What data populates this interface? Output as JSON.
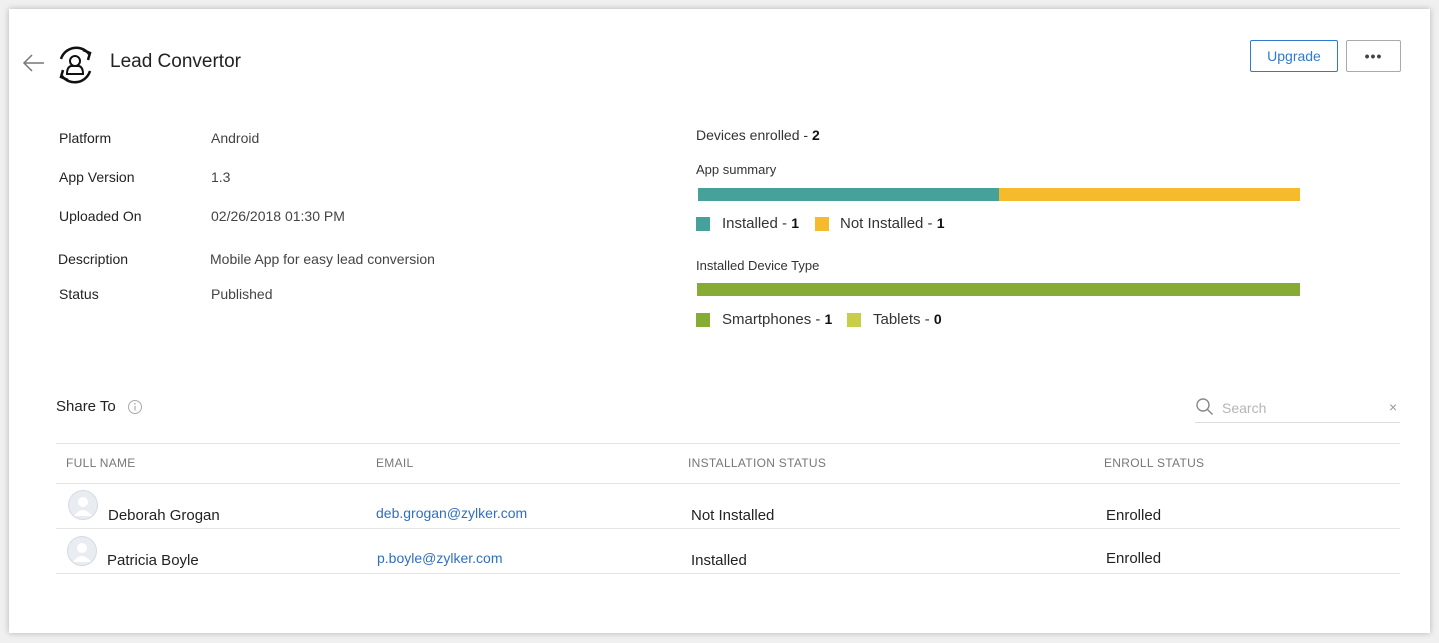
{
  "header": {
    "title": "Lead Convertor",
    "upgrade_label": "Upgrade",
    "more_label": "•••"
  },
  "details": {
    "platform": {
      "label": "Platform",
      "value": "Android"
    },
    "app_version": {
      "label": "App Version",
      "value": "1.3"
    },
    "uploaded_on": {
      "label": "Uploaded On",
      "value": "02/26/2018 01:30 PM"
    },
    "description": {
      "label": "Description",
      "value": "Mobile App for easy lead conversion"
    },
    "status": {
      "label": "Status",
      "value": "Published"
    }
  },
  "summary": {
    "devices_enrolled_label": "Devices enrolled - ",
    "devices_enrolled_count": "2",
    "app_summary": {
      "title": "App summary",
      "installed_label": "Installed - ",
      "installed_count": "1",
      "not_installed_label": "Not Installed - ",
      "not_installed_count": "1",
      "installed_fraction": 0.5,
      "installed_color": "#45a199",
      "not_installed_color": "#f5bb2d"
    },
    "device_type": {
      "title": "Installed Device Type",
      "smartphones_label": "Smartphones - ",
      "smartphones_count": "1",
      "tablets_label": "Tablets - ",
      "tablets_count": "0",
      "smartphones_fraction": 1.0,
      "smartphones_color": "#86ac35",
      "tablets_color": "#c8ce47"
    }
  },
  "share": {
    "title": "Share To",
    "search_placeholder": "Search",
    "clear_label": "×",
    "columns": [
      "FULL NAME",
      "EMAIL",
      "INSTALLATION STATUS",
      "ENROLL STATUS"
    ],
    "rows": [
      {
        "name": "Deborah Grogan",
        "email": "deb.grogan@zylker.com",
        "installation": "Not Installed",
        "enroll": "Enrolled"
      },
      {
        "name": "Patricia Boyle",
        "email": "p.boyle@zylker.com",
        "installation": "Installed",
        "enroll": "Enrolled"
      }
    ]
  },
  "icons": {
    "back": "arrow-left-icon",
    "app": "lead-convertor-app-icon",
    "info": "info-icon",
    "search": "search-icon",
    "avatar": "user-avatar-icon"
  }
}
